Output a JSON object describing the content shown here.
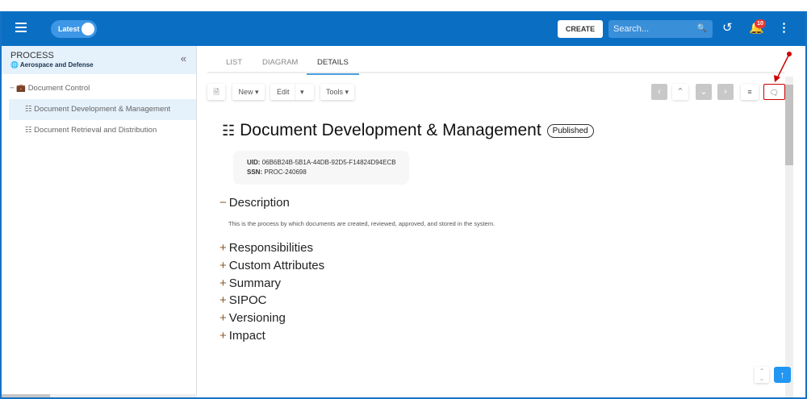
{
  "header": {
    "toggle_label": "Latest",
    "create_label": "CREATE",
    "search_placeholder": "Search...",
    "notification_count": "10"
  },
  "sidebar": {
    "title": "PROCESS",
    "subtitle": "Aerospace and Defense",
    "items": [
      {
        "label": "Document Control"
      },
      {
        "label": "Document Development & Management"
      },
      {
        "label": "Document Retrieval and Distribution"
      }
    ]
  },
  "tabs": [
    {
      "label": "LIST"
    },
    {
      "label": "DIAGRAM"
    },
    {
      "label": "DETAILS"
    }
  ],
  "toolbar": {
    "new_label": "New",
    "edit_label": "Edit",
    "tools_label": "Tools"
  },
  "detail": {
    "title": "Document Development & Management",
    "status": "Published",
    "uid_label": "UID:",
    "uid": "06B6B24B-5B1A-44DB-92D5-F14824D94ECB",
    "ssn_label": "SSN:",
    "ssn": "PROC-240698",
    "description_heading": "Description",
    "description": "This is the process by which documents are created, reviewed, approved, and stored in the system.",
    "sections": [
      "Responsibilities",
      "Custom Attributes",
      "Summary",
      "SIPOC",
      "Versioning",
      "Impact"
    ]
  },
  "colors": {
    "header": "#0a6fc3",
    "accent": "#2196f3",
    "annotation": "#cc0000"
  }
}
